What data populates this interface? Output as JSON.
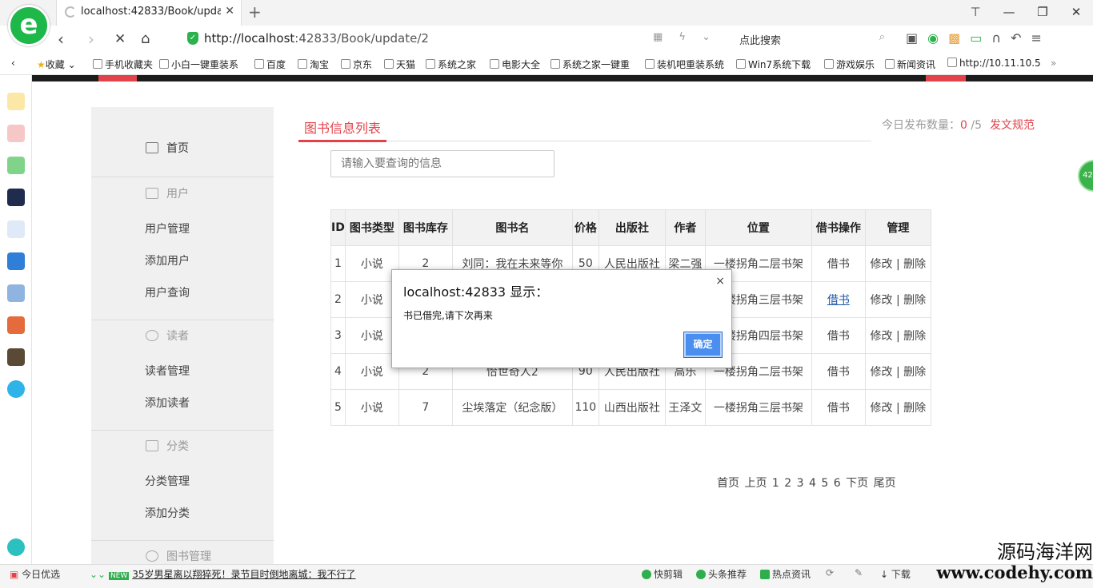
{
  "browser": {
    "tab_title": "localhost:42833/Book/update/2",
    "url_main": "http://localhost",
    "url_rest": ":42833/Book/update/2",
    "search_placeholder": "点此搜索",
    "bookmarks": [
      "收藏",
      "手机收藏夹",
      "小白一键重装系",
      "百度",
      "淘宝",
      "京东",
      "天猫",
      "系统之家",
      "电影大全",
      "系统之家一键重",
      "装机吧重装系统",
      "Win7系统下载",
      "游戏娱乐",
      "新闻资讯",
      "http://10.11.10.5"
    ],
    "logo_letter": "e"
  },
  "menu": {
    "home": "首页",
    "sections": [
      {
        "title": "用户",
        "items": [
          "用户管理",
          "添加用户",
          "用户查询"
        ]
      },
      {
        "title": "读者",
        "items": [
          "读者管理",
          "添加读者"
        ]
      },
      {
        "title": "分类",
        "items": [
          "分类管理",
          "添加分类"
        ]
      },
      {
        "title": "图书管理",
        "items": []
      }
    ]
  },
  "main": {
    "tab_label": "图书信息列表",
    "daily_label": "今日发布数量：",
    "daily_count": "0",
    "daily_total": "/5",
    "rules_link": "发文规范",
    "search_placeholder": "请输入要查询的信息",
    "headers": [
      "ID",
      "图书类型",
      "图书库存",
      "图书名",
      "价格",
      "出版社",
      "作者",
      "位置",
      "借书操作",
      "管理"
    ],
    "rows": [
      {
        "id": "1",
        "type": "小说",
        "stock": "2",
        "name": "刘同：我在未来等你",
        "price": "50",
        "publisher": "人民出版社",
        "author": "梁二强",
        "location": "一楼拐角二层书架",
        "borrow": "借书",
        "edit": "修改",
        "sep": "|",
        "del": "删除"
      },
      {
        "id": "2",
        "type": "小说",
        "stock": "",
        "name": "",
        "price": "",
        "publisher": "",
        "author": "",
        "location": "一楼拐角三层书架",
        "borrow": "借书",
        "edit": "修改",
        "sep": "|",
        "del": "删除"
      },
      {
        "id": "3",
        "type": "小说",
        "stock": "",
        "name": "",
        "price": "",
        "publisher": "",
        "author": "",
        "location": "一楼拐角四层书架",
        "borrow": "借书",
        "edit": "修改",
        "sep": "|",
        "del": "删除"
      },
      {
        "id": "4",
        "type": "小说",
        "stock": "2",
        "name": "恰世奇人2",
        "price": "90",
        "publisher": "人民出版社",
        "author": "高乐",
        "location": "一楼拐角二层书架",
        "borrow": "借书",
        "edit": "修改",
        "sep": "|",
        "del": "删除"
      },
      {
        "id": "5",
        "type": "小说",
        "stock": "7",
        "name": "尘埃落定（纪念版）",
        "price": "110",
        "publisher": "山西出版社",
        "author": "王泽文",
        "location": "一楼拐角三层书架",
        "borrow": "借书",
        "edit": "修改",
        "sep": "|",
        "del": "删除"
      }
    ],
    "pager": [
      "首页",
      "上页",
      "1",
      "2",
      "3",
      "4",
      "5",
      "6",
      "下页",
      "尾页"
    ]
  },
  "dialog": {
    "title": "localhost:42833 显示：",
    "message": "书已借完,请下次再来",
    "ok": "确定",
    "close": "×"
  },
  "statusbar": {
    "today": "今日优选",
    "new_badge": "NEW",
    "news": "35岁男星离以翔猝死！录节目时倒地离城：我不行了",
    "items": [
      "快剪辑",
      "头条推荐",
      "热点资讯",
      "下载"
    ]
  },
  "watermark": {
    "line1": "源码海洋网",
    "line2": "www.codehy.com"
  },
  "colors": {
    "accent_red": "#e2434b",
    "ok_blue": "#4a8ef0",
    "browser_green": "#1eb84a"
  }
}
